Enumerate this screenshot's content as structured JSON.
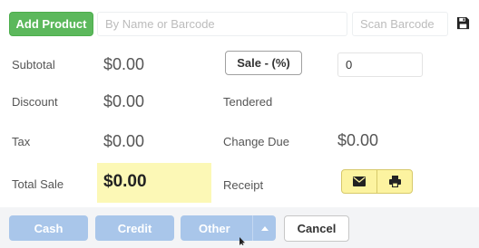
{
  "toolbar": {
    "add_product_label": "Add Product",
    "search_placeholder": "By Name or Barcode",
    "barcode_placeholder": "Scan Barcode",
    "save_icon": "floppy-disk-icon"
  },
  "summary": {
    "subtotal_label": "Subtotal",
    "subtotal_value": "$0.00",
    "discount_label": "Discount",
    "discount_value": "$0.00",
    "tax_label": "Tax",
    "tax_value": "$0.00",
    "total_label": "Total Sale",
    "total_value": "$0.00"
  },
  "payment": {
    "sale_button_label": "Sale - (%)",
    "discount_percent_value": "0",
    "tendered_label": "Tendered",
    "change_due_label": "Change Due",
    "change_due_value": "$0.00",
    "receipt_label": "Receipt",
    "receipt_icons": [
      "envelope-icon",
      "printer-icon"
    ]
  },
  "footer": {
    "cash_label": "Cash",
    "credit_label": "Credit",
    "other_label": "Other",
    "cancel_label": "Cancel"
  },
  "colors": {
    "add_product_green": "#5cb85c",
    "total_highlight": "#fcf8b6",
    "receipt_yellow": "#fcf3a0",
    "payment_blue": "#a9c6ea"
  }
}
